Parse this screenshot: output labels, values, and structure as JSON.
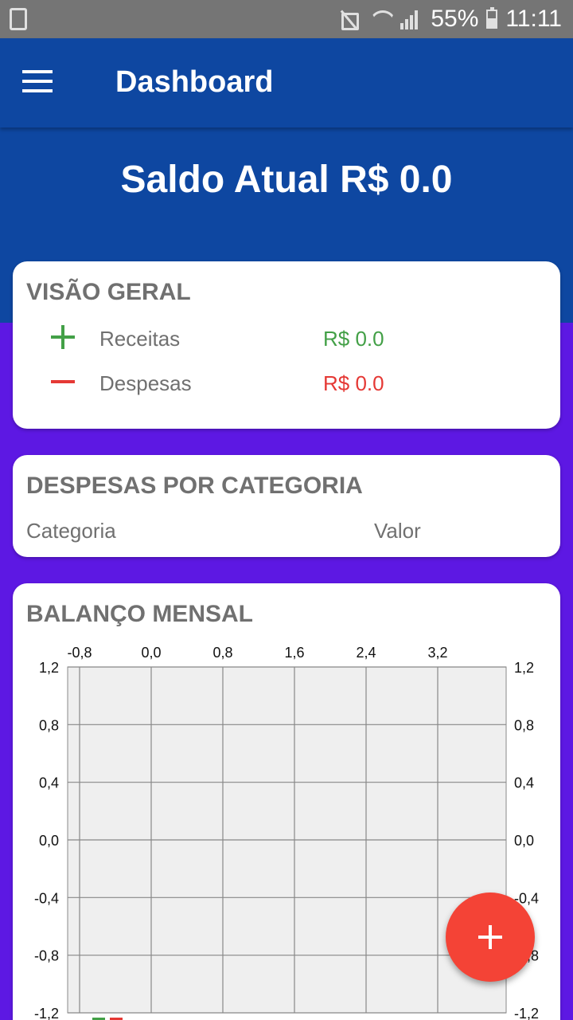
{
  "status_bar": {
    "battery": "55%",
    "time": "11:11"
  },
  "app_bar": {
    "title": "Dashboard"
  },
  "hero": {
    "saldo": "Saldo Atual R$ 0.0"
  },
  "overview": {
    "title": "VISÃO GERAL",
    "receitas_label": "Receitas",
    "receitas_value": "R$ 0.0",
    "despesas_label": "Despesas",
    "despesas_value": "R$ 0.0"
  },
  "categories": {
    "title": "DESPESAS POR CATEGORIA",
    "col_category": "Categoria",
    "col_value": "Valor"
  },
  "monthly": {
    "title": "BALANÇO MENSAL"
  },
  "colors": {
    "primary": "#0e47a1",
    "background": "#5d18e3",
    "income": "#43a047",
    "expense": "#e53935",
    "fab": "#f44336"
  },
  "icons": [
    "menu-icon",
    "plus-icon",
    "minus-icon",
    "add-icon"
  ],
  "chart_data": {
    "type": "bar",
    "title": "",
    "x_ticks": [
      "-0,8",
      "0,0",
      "0,8",
      "1,6",
      "2,4",
      "3,2"
    ],
    "x_tick_values": [
      -0.8,
      0.0,
      0.8,
      1.6,
      2.4,
      3.2
    ],
    "y_ticks": [
      "1,2",
      "0,8",
      "0,4",
      "0,0",
      "-0,4",
      "-0,8",
      "-1,2"
    ],
    "y_tick_values": [
      1.2,
      0.8,
      0.4,
      0.0,
      -0.4,
      -0.8,
      -1.2
    ],
    "ylim": [
      -1.2,
      1.2
    ],
    "grid": true,
    "series": [
      {
        "values": [],
        "color": "#43a047"
      },
      {
        "values": [],
        "color": "#e53935"
      }
    ]
  }
}
